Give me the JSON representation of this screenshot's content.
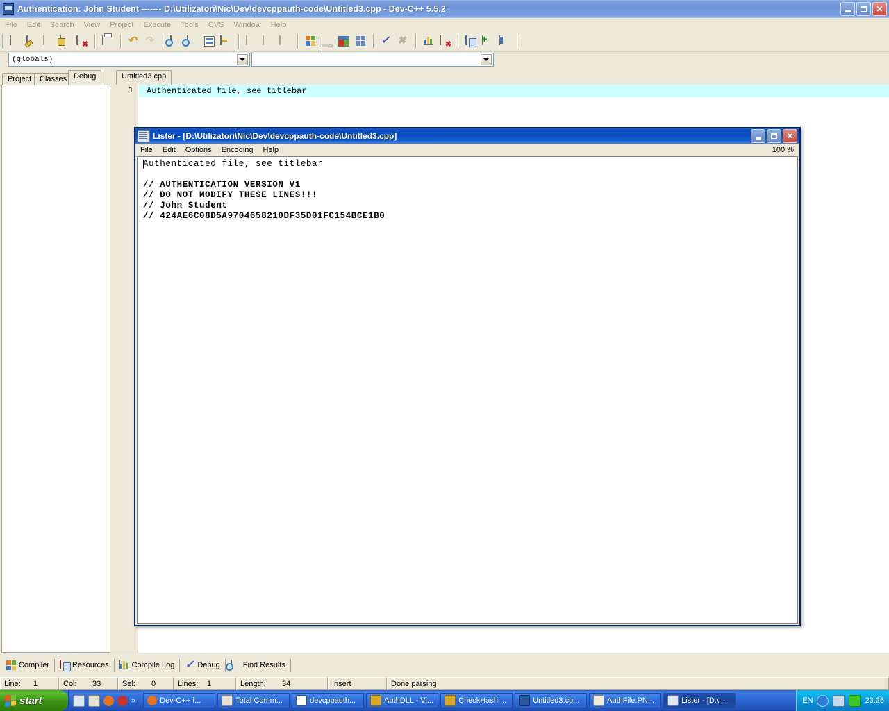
{
  "main_window": {
    "title": "Authentication: John Student ------- D:\\Utilizatori\\Nic\\Dev\\devcppauth-code\\Untitled3.cpp - Dev-C++ 5.5.2",
    "icon": "devcpp-icon",
    "controls": {
      "minimize": "_",
      "maximize": "□",
      "close": "✕"
    }
  },
  "menu": {
    "items": [
      "File",
      "Edit",
      "Search",
      "View",
      "Project",
      "Execute",
      "Tools",
      "CVS",
      "Window",
      "Help"
    ]
  },
  "toolbar": {
    "groups": [
      {
        "buttons": [
          {
            "name": "new-file-icon",
            "label": "New"
          },
          {
            "name": "open-file-icon",
            "label": "Open"
          },
          {
            "name": "save-gray-icon",
            "label": "Save"
          },
          {
            "name": "save-all-icon",
            "label": "Save All"
          },
          {
            "name": "close-file-icon",
            "label": "Close"
          }
        ]
      },
      {
        "buttons": [
          {
            "name": "print-icon",
            "label": "Print"
          }
        ]
      },
      {
        "buttons": [
          {
            "name": "undo-icon",
            "label": "Undo"
          },
          {
            "name": "redo-icon",
            "label": "Redo"
          }
        ]
      },
      {
        "buttons": [
          {
            "name": "find-icon",
            "label": "Find"
          },
          {
            "name": "find-next-icon",
            "label": "Find Next"
          },
          {
            "name": "replace-icon",
            "label": "Replace"
          },
          {
            "name": "goto-line-icon",
            "label": "Goto Line"
          }
        ]
      },
      {
        "buttons": [
          {
            "name": "back-icon",
            "label": "Back"
          },
          {
            "name": "forward-icon",
            "label": "Forward"
          },
          {
            "name": "toggle-icon",
            "label": "Toggle"
          }
        ]
      },
      {
        "buttons": [
          {
            "name": "new-project-icon",
            "label": "New Project"
          },
          {
            "name": "project-options-icon",
            "label": "Project Options"
          },
          {
            "name": "environment-options-icon",
            "label": "Environment Options"
          },
          {
            "name": "tile-windows-icon",
            "label": "Tile"
          }
        ]
      },
      {
        "buttons": [
          {
            "name": "compile-check-icon",
            "label": "Compile"
          },
          {
            "name": "stop-execution-icon",
            "label": "Stop Execution"
          }
        ]
      },
      {
        "buttons": [
          {
            "name": "profile-analysis-icon",
            "label": "Profile Analysis"
          },
          {
            "name": "delete-profile-icon",
            "label": "Delete Profile"
          }
        ]
      },
      {
        "buttons": [
          {
            "name": "add-to-project-icon",
            "label": "Add To Project"
          },
          {
            "name": "insert-icon",
            "label": "Insert"
          },
          {
            "name": "toggle-bookmark-icon",
            "label": "Toggle Bookmark"
          }
        ]
      }
    ]
  },
  "combo_row": {
    "scope": {
      "value": "(globals)",
      "placeholder": ""
    },
    "symbol": {
      "value": "",
      "placeholder": ""
    }
  },
  "left_tabs": {
    "items": [
      "Project",
      "Classes",
      "Debug"
    ],
    "active": "Debug"
  },
  "editor_tabs": {
    "items": [
      "Untitled3.cpp"
    ],
    "active": "Untitled3.cpp"
  },
  "editor": {
    "line_numbers": [
      "1"
    ],
    "line_text_before": "Authenticated file",
    "line_text_punct": ",",
    "line_text_after": " see titlebar"
  },
  "lister": {
    "title": "Lister - [D:\\Utilizatori\\Nic\\Dev\\devcppauth-code\\Untitled3.cpp]",
    "icon": "lister-icon",
    "menu": [
      "File",
      "Edit",
      "Options",
      "Encoding",
      "Help"
    ],
    "zoom": "100 %",
    "controls": {
      "minimize": "_",
      "maximize": "□",
      "close": "✕"
    },
    "content_lines": [
      "Authenticated file, see titlebar",
      "",
      "// AUTHENTICATION VERSION V1",
      "// DO NOT MODIFY THESE LINES!!!",
      "// John Student",
      "// 424AE6C08D5A9704658210DF35D01FC154BCE1B0"
    ]
  },
  "bottom_tabs": {
    "items": [
      {
        "label": "Compiler",
        "icon": "compiler-icon"
      },
      {
        "label": "Resources",
        "icon": "resources-icon"
      },
      {
        "label": "Compile Log",
        "icon": "compile-log-icon"
      },
      {
        "label": "Debug",
        "icon": "debug-check-icon"
      },
      {
        "label": "Find Results",
        "icon": "find-results-icon"
      }
    ]
  },
  "status_bar": {
    "line_label": "Line:",
    "line_value": "1",
    "col_label": "Col:",
    "col_value": "33",
    "sel_label": "Sel:",
    "sel_value": "0",
    "lines_label": "Lines:",
    "lines_value": "1",
    "length_label": "Length:",
    "length_value": "34",
    "mode": "Insert",
    "message": "Done parsing"
  },
  "taskbar": {
    "start_label": "start",
    "quick_launch": [
      "show-desktop-icon",
      "media-player-icon",
      "firefox-icon",
      "opera-icon"
    ],
    "quick_launch_overflow": "»",
    "tasks": [
      {
        "label": "Dev-C++ f...",
        "icon": "firefox-icon",
        "active": false
      },
      {
        "label": "Total Comm...",
        "icon": "total-commander-icon",
        "active": false
      },
      {
        "label": "devcppauth...",
        "icon": "code-icon",
        "active": false
      },
      {
        "label": "AuthDLL - Vi...",
        "icon": "visualstudio-icon",
        "active": false
      },
      {
        "label": "CheckHash ...",
        "icon": "visualstudio-icon",
        "active": false
      },
      {
        "label": "Untitled3.cp...",
        "icon": "devcpp-icon",
        "active": false
      },
      {
        "label": "AuthFile.PN...",
        "icon": "paint-icon",
        "active": false
      },
      {
        "label": "Lister - [D:\\...",
        "icon": "lister-icon",
        "active": true
      }
    ],
    "tray": {
      "language": "EN",
      "icons": [
        "volume-icon",
        "network-icon",
        "firewall-icon"
      ],
      "clock": "23:26"
    }
  },
  "colors": {
    "desktop_chrome": "#ECE9D8",
    "active_title": "#0A4BC0",
    "inactive_title": "#6C93D8",
    "current_line_highlight": "#CCFFFF",
    "punct_red": "#E00000",
    "taskbar_blue": "#2F6BD8",
    "start_green": "#3C9114"
  }
}
